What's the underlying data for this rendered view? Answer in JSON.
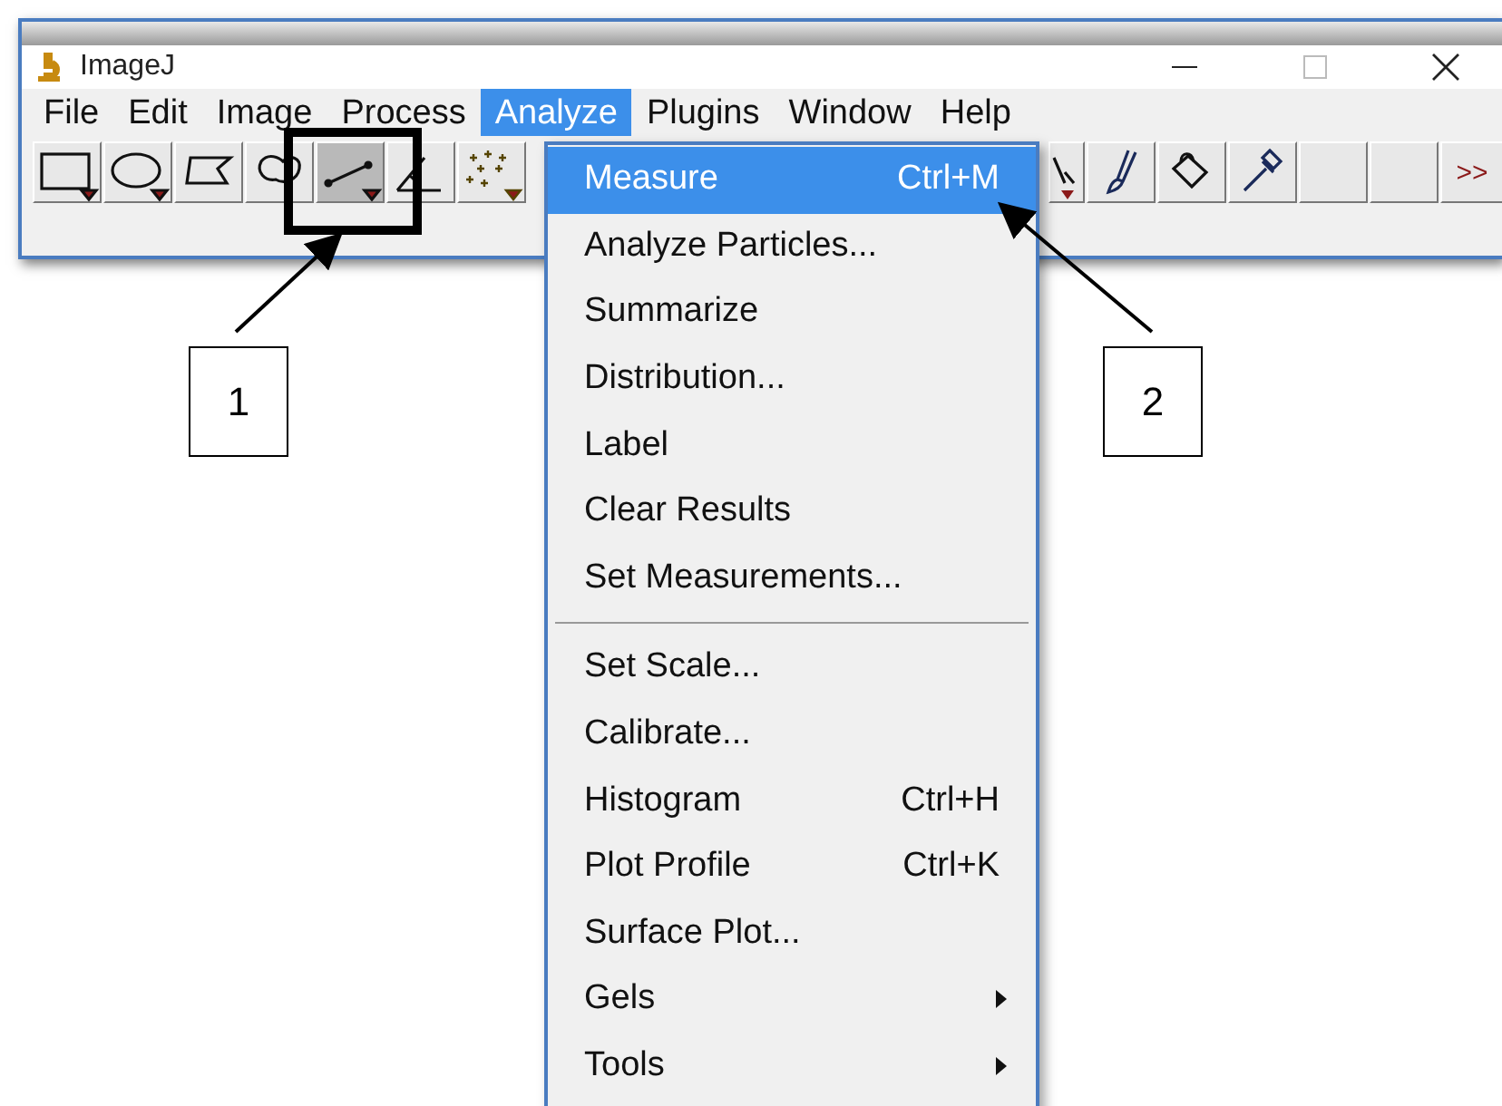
{
  "window": {
    "title": "ImageJ"
  },
  "menubar": [
    {
      "label": "File",
      "selected": false
    },
    {
      "label": "Edit",
      "selected": false
    },
    {
      "label": "Image",
      "selected": false
    },
    {
      "label": "Process",
      "selected": false
    },
    {
      "label": "Analyze",
      "selected": true
    },
    {
      "label": "Plugins",
      "selected": false
    },
    {
      "label": "Window",
      "selected": false
    },
    {
      "label": "Help",
      "selected": false
    }
  ],
  "toolbar": {
    "left": [
      {
        "kind": "rectangle",
        "selected": false
      },
      {
        "kind": "oval",
        "selected": false
      },
      {
        "kind": "polygon",
        "selected": false
      },
      {
        "kind": "freehand",
        "selected": false
      },
      {
        "kind": "line",
        "selected": true
      },
      {
        "kind": "angle",
        "selected": false
      },
      {
        "kind": "point",
        "selected": false
      }
    ],
    "right": [
      {
        "kind": "partial",
        "selected": false
      },
      {
        "kind": "brush",
        "selected": false
      },
      {
        "kind": "bucket",
        "selected": false
      },
      {
        "kind": "dropper",
        "selected": false
      },
      {
        "kind": "empty",
        "selected": false
      },
      {
        "kind": "empty",
        "selected": false
      }
    ],
    "more": ">>"
  },
  "menu": [
    {
      "label": "Measure",
      "shortcut": "Ctrl+M",
      "selected": true
    },
    {
      "label": "Analyze Particles...",
      "selected": false
    },
    {
      "label": "Summarize",
      "selected": false
    },
    {
      "label": "Distribution...",
      "selected": false
    },
    {
      "label": "Label",
      "selected": false
    },
    {
      "label": "Clear Results",
      "selected": false
    },
    {
      "label": "Set Measurements...",
      "selected": false,
      "separator_after": true
    },
    {
      "label": "Set Scale...",
      "selected": false
    },
    {
      "label": "Calibrate...",
      "selected": false
    },
    {
      "label": "Histogram",
      "shortcut": "Ctrl+H",
      "selected": false
    },
    {
      "label": "Plot Profile",
      "shortcut": "Ctrl+K",
      "selected": false
    },
    {
      "label": "Surface Plot...",
      "selected": false
    },
    {
      "label": "Gels",
      "submenu": true,
      "selected": false
    },
    {
      "label": "Tools",
      "submenu": true,
      "selected": false
    }
  ],
  "callouts": [
    {
      "label": "1"
    },
    {
      "label": "2"
    }
  ]
}
